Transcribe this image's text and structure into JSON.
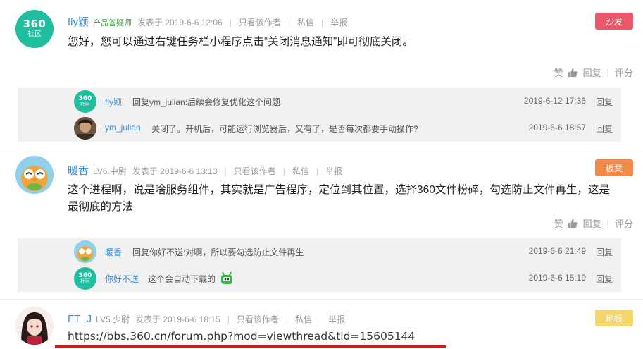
{
  "posts": [
    {
      "username": "fly颖",
      "badge": "产品答疑师",
      "posted": "发表于 2019-6-6 12:06",
      "only_author": "只看该作者",
      "message": "私信",
      "report": "举报",
      "floor": "沙发",
      "content": "您好，您可以通过右键任务栏小程序点击“关闭消息通知”即可彻底关闭。",
      "like": "赞",
      "reply": "回复",
      "rate": "评分",
      "replies": [
        {
          "name": "fly颖",
          "text": "回复ym_julian:后续会修复优化这个问题",
          "time": "2019-6-12 17:36",
          "reply": "回复"
        },
        {
          "name": "ym_julian",
          "text": "关闭了。开机后，可能运行浏览器后，又有了，是否每次都要手动操作?",
          "time": "2019-6-6 18:57",
          "reply": "回复"
        }
      ]
    },
    {
      "username": "暖香",
      "level": "LV6.中尉",
      "posted": "发表于 2019-6-6 13:13",
      "only_author": "只看该作者",
      "message": "私信",
      "report": "举报",
      "floor": "板凳",
      "content_line1": "这个进程啊，说是啥服务组件，其实就是广告程序，定位到其位置，选择360文件粉碎，勾选防止文件再生，这是",
      "content_line2": "最彻底的方法",
      "like": "赞",
      "reply": "回复",
      "rate": "评分",
      "replies": [
        {
          "name": "暖香",
          "text": "回复你好不送:对啊，所以要勾选防止文件再生",
          "time": "2019-6-6 21:49",
          "reply": "回复"
        },
        {
          "name": "你好不送",
          "text": "这个会自动下载的",
          "time": "2019-6-6 15:19",
          "reply": "回复"
        }
      ]
    },
    {
      "username": "FT_J",
      "level": "LV5.少尉",
      "posted": "发表于 2019-6-6 18:15",
      "only_author": "只看该作者",
      "message": "私信",
      "report": "举报",
      "floor": "地板",
      "content": "https://bbs.360.cn/forum.php?mod=viewthread&tid=15605144"
    }
  ],
  "avatar_360": {
    "top": "360",
    "bottom": "社区"
  },
  "colors": {
    "floor_sofa": "#e9586a",
    "floor_bench": "#f08a4b",
    "floor_floor": "#f5d66a",
    "accent": "#3b8ed8",
    "brand": "#1fbe9f"
  }
}
